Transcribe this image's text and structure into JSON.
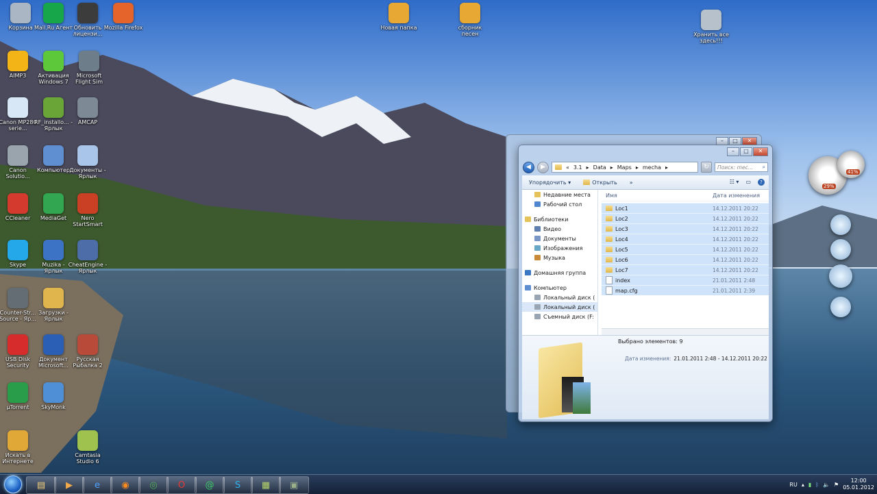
{
  "desktop_icons": [
    {
      "label": "Корзина"
    },
    {
      "label": "Mail.Ru Агент"
    },
    {
      "label": "Обновить лицензи..."
    },
    {
      "label": "Mozilla Firefox"
    },
    {
      "label": "Новая папка"
    },
    {
      "label": "сборник песен"
    },
    {
      "label": "Хранить все здесь!!!"
    },
    {
      "label": "AIMP3"
    },
    {
      "label": "Активация Windows 7"
    },
    {
      "label": "Microsoft Flight Sim"
    },
    {
      "label": "Canon MP280 serie..."
    },
    {
      "label": "RF_installo... - Ярлык"
    },
    {
      "label": "AMCAP"
    },
    {
      "label": "Canon Solutio..."
    },
    {
      "label": "Компьютер"
    },
    {
      "label": "Документы - Ярлык"
    },
    {
      "label": "CCleaner"
    },
    {
      "label": "MediaGet"
    },
    {
      "label": "Nero StartSmart"
    },
    {
      "label": "Skype"
    },
    {
      "label": "Muzika - Ярлык"
    },
    {
      "label": "CheatEngine - Ярлык"
    },
    {
      "label": "Counter-Str... Source - Яр..."
    },
    {
      "label": "Загрузки - Ярлык"
    },
    {
      "label": "USB Disk Security"
    },
    {
      "label": "Документ Microsoft..."
    },
    {
      "label": "Русская Рыбалка 2"
    },
    {
      "label": "µTorrent"
    },
    {
      "label": "SkyMonk"
    },
    {
      "label": "Искать в Интернете"
    },
    {
      "label": "Camtasia Studio 6"
    }
  ],
  "gadgets": {
    "meter_cpu": "29%",
    "meter_mem": "41%"
  },
  "explorer": {
    "caption": {
      "minimize": "–",
      "maximize": "□",
      "close": "✕"
    },
    "address": {
      "prefix": "«",
      "segments": [
        "3.1",
        "Data",
        "Maps",
        "mecha"
      ],
      "search_placeholder": "Поиск: mec..."
    },
    "toolbar": {
      "organize": "Упорядочить",
      "open": "Открыть",
      "more": "»"
    },
    "nav": [
      {
        "label": "Недавние места"
      },
      {
        "label": "Рабочий стол"
      },
      {
        "label": "Библиотеки"
      },
      {
        "label": "Видео"
      },
      {
        "label": "Документы"
      },
      {
        "label": "Изображения"
      },
      {
        "label": "Музыка"
      },
      {
        "label": "Домашняя группа"
      },
      {
        "label": "Компьютер"
      },
      {
        "label": "Локальный диск ("
      },
      {
        "label": "Локальный диск ("
      },
      {
        "label": "Съемный диск (F:"
      }
    ],
    "columns": {
      "name": "Имя",
      "date": "Дата изменения"
    },
    "files": [
      {
        "name": "Loc1",
        "date": "14.12.2011 20:22",
        "kind": "folder"
      },
      {
        "name": "Loc2",
        "date": "14.12.2011 20:22",
        "kind": "folder"
      },
      {
        "name": "Loc3",
        "date": "14.12.2011 20:22",
        "kind": "folder"
      },
      {
        "name": "Loc4",
        "date": "14.12.2011 20:22",
        "kind": "folder"
      },
      {
        "name": "Loc5",
        "date": "14.12.2011 20:22",
        "kind": "folder"
      },
      {
        "name": "Loc6",
        "date": "14.12.2011 20:22",
        "kind": "folder"
      },
      {
        "name": "Loc7",
        "date": "14.12.2011 20:22",
        "kind": "folder"
      },
      {
        "name": "index",
        "date": "21.01.2011 2:48",
        "kind": "file"
      },
      {
        "name": "map.cfg",
        "date": "21.01.2011 2:39",
        "kind": "file"
      }
    ],
    "details": {
      "selected": "Выбрано элементов: 9",
      "date_label": "Дата изменения:",
      "date_value": "21.01.2011 2:48 - 14.12.2011 20:22"
    }
  },
  "taskbar": {
    "apps": [
      "folder-icon",
      "media-player-icon",
      "ie-icon",
      "firefox-icon",
      "chrome-icon",
      "opera-icon",
      "mailru-icon",
      "skype-icon",
      "camtasia-icon",
      "game-icon"
    ],
    "tray": {
      "lang": "RU",
      "time": "12:00",
      "date": "05.01.2012"
    }
  }
}
